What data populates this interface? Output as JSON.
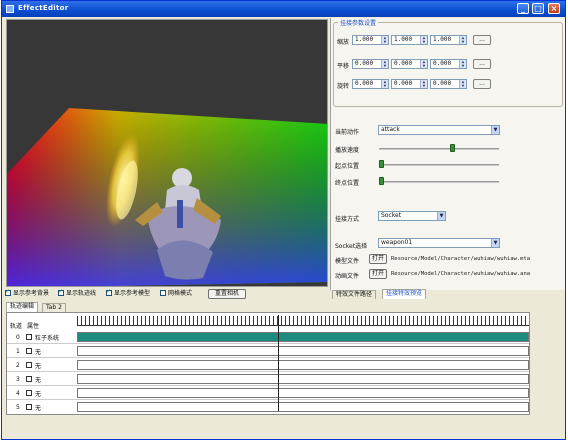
{
  "window": {
    "title": "EffectEditor"
  },
  "viewport": {
    "background": "#373737"
  },
  "panel": {
    "group_title": "挂接参数设置",
    "rows": [
      {
        "label": "缩放",
        "values": [
          "1.000",
          "1.000",
          "1.000"
        ],
        "button": "..."
      },
      {
        "label": "平移",
        "values": [
          "0.000",
          "0.000",
          "0.000"
        ],
        "button": "..."
      },
      {
        "label": "旋转",
        "values": [
          "0.000",
          "0.000",
          "0.000"
        ],
        "button": "..."
      }
    ],
    "action_label": "当前动作",
    "action_value": "attack",
    "speed_label": "播放速度",
    "speed_level": 0.62,
    "start_label": "起点位置",
    "start_level": 0.0,
    "end_label": "终点位置",
    "end_level": 0.0,
    "attach_label": "挂接方式",
    "attach_value": "Socket",
    "socket_label": "Socket选择",
    "socket_value": "weapon01",
    "model_label": "模型文件",
    "model_button": "打开",
    "model_path": "Resource/Model/Character/wuhiaw/wuhiaw.mta",
    "anim_label": "动画文件",
    "anim_button": "打开",
    "anim_path": "Resource/Model/Character/wuhiaw/wuhiaw.ana"
  },
  "panel_tabs": [
    "特效文件路径",
    "挂接特效预览"
  ],
  "checkboxes": [
    {
      "label": "显示参考背景",
      "checked": true
    },
    {
      "label": "显示轨迹线",
      "checked": true
    },
    {
      "label": "显示参考模型",
      "checked": true
    },
    {
      "label": "网格模式",
      "checked": false
    }
  ],
  "reset_camera_label": "重置相机",
  "timeline_tabs": [
    "轨迹编辑",
    "Tab 2"
  ],
  "timeline": {
    "header_left": "轨道",
    "header_right": "属性",
    "rows": [
      {
        "num": "0",
        "name": "粒子系统",
        "filled": true
      },
      {
        "num": "1",
        "name": "无",
        "filled": false
      },
      {
        "num": "2",
        "name": "无",
        "filled": false
      },
      {
        "num": "3",
        "name": "无",
        "filled": false
      },
      {
        "num": "4",
        "name": "无",
        "filled": false
      },
      {
        "num": "5",
        "name": "无",
        "filled": false
      }
    ]
  }
}
